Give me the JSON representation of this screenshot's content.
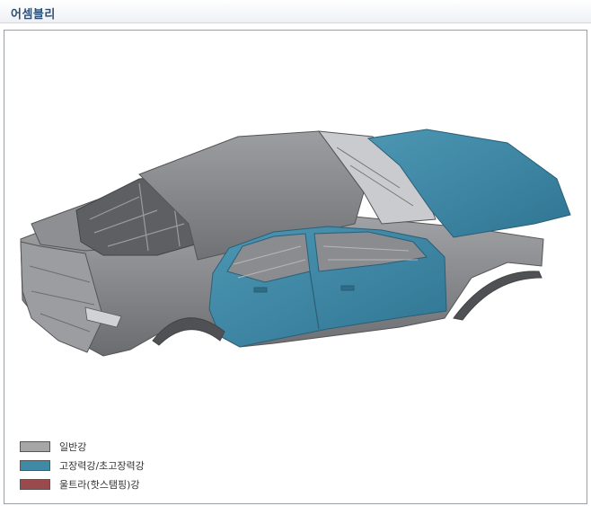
{
  "header": {
    "title": "어셈블리"
  },
  "figure": {
    "colors": {
      "general_steel": "#8f9194",
      "high_strength_steel": "#3f8aa6",
      "ultra_hot_stamping_steel": "#9a4a4c"
    },
    "icon": "car-body-in-white-image"
  },
  "legend": {
    "items": [
      {
        "label": "일반강",
        "color": "#a6a6a6"
      },
      {
        "label": "고장력강/초고장력강",
        "color": "#3f8aa6"
      },
      {
        "label": "울트라(핫스탬핑)강",
        "color": "#9a4a4c"
      }
    ]
  }
}
